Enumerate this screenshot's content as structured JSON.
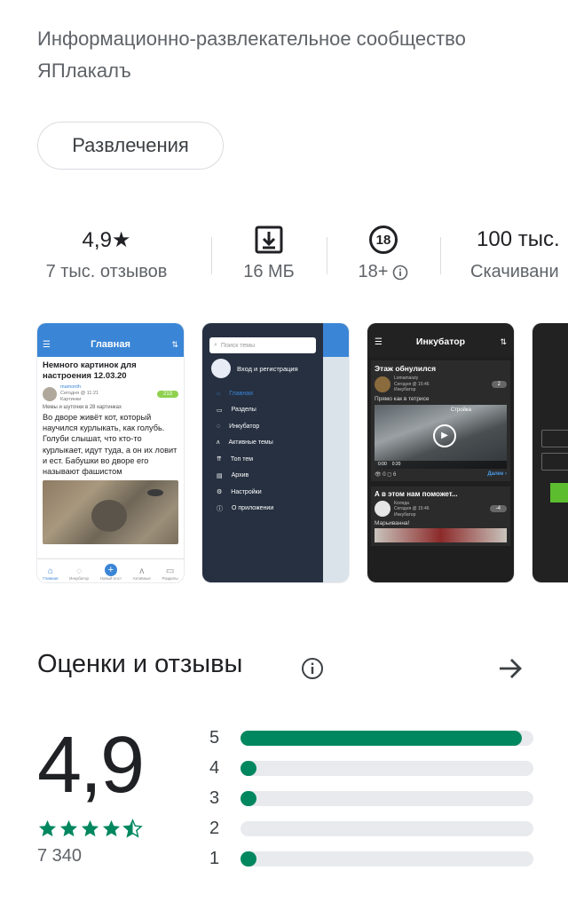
{
  "app": {
    "subtitle": "Информационно-развлекательное сообщество ЯПлакалъ",
    "category_chip": "Развлечения"
  },
  "stats": {
    "rating_value": "4,9★",
    "rating_label": "7 тыс. отзывов",
    "size_label": "16 МБ",
    "age_badge": "18",
    "age_label": "18+",
    "downloads_value": "100 тыс.",
    "downloads_label": "Скачивани"
  },
  "screenshots": {
    "s1": {
      "header": "Главная",
      "post_title": "Немного картинок для настроения 12.03.20",
      "post_author": "mamonth",
      "post_time": "Сегодня @ 11:21",
      "post_category": "Картинки",
      "post_badge": "213",
      "post_sub": "Мемы и шуточки в 28 картинках",
      "post_text": "Во дворе живёт кот, который научился курлыкать, как голубь. Голуби слышат, что кто-то курлыкает, идут туда, а он их ловит и ест. Бабушки во дворе его называют фашистом",
      "nav": [
        "Главная",
        "Инкубатор",
        "Новый пост",
        "Активные",
        "Разделы"
      ]
    },
    "s2": {
      "search_placeholder": "Поиск темы",
      "login": "Вход и регистрация",
      "menu": [
        "Главная",
        "Разделы",
        "Инкубатор",
        "Активные темы",
        "Топ тем",
        "Архив",
        "Настройки",
        "О приложении"
      ]
    },
    "s3": {
      "header": "Инкубатор",
      "post1_title": "Этаж обнулился",
      "post1_author": "Lomamaiuty",
      "post1_time": "Сегодня @ 15:46",
      "post1_cat": "Инкубатор",
      "post1_badge": "2",
      "post1_text": "Прямо как в тетрисе",
      "video_label": "Стройка",
      "video_time": "0:00",
      "video_total": "0:20",
      "stats_views": "0",
      "stats_comments": "6",
      "more": "Далее ›",
      "post2_title": "А в этом нам поможет...",
      "post2_author": "Коляда",
      "post2_time": "Сегодня @ 15:46",
      "post2_cat": "Инкубатор",
      "post2_badge": "-4",
      "post2_text": "Марьиванна!"
    }
  },
  "ratings": {
    "title": "Оценки и отзывы",
    "score": "4,9",
    "count": "7 340",
    "stars_value": 4.7,
    "distribution": [
      {
        "label": "5",
        "fraction": 0.96
      },
      {
        "label": "4",
        "fraction": 0.02
      },
      {
        "label": "3",
        "fraction": 0.02
      },
      {
        "label": "2",
        "fraction": 0.0
      },
      {
        "label": "1",
        "fraction": 0.02
      }
    ]
  },
  "colors": {
    "accent": "#01875f",
    "track": "#e8eaed",
    "app_blue": "#3a85d6"
  }
}
